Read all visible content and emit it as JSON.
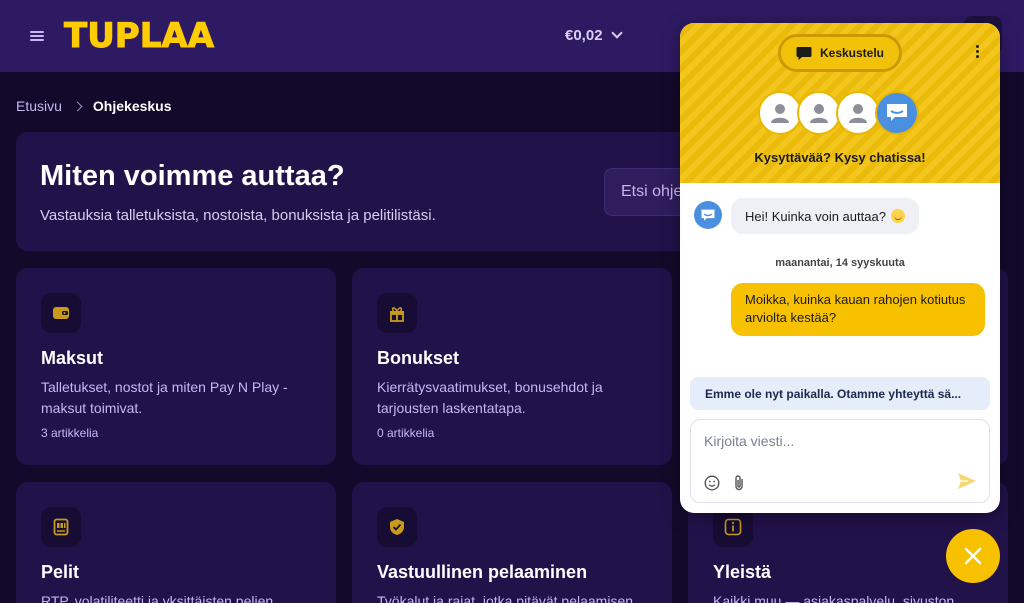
{
  "header": {
    "logo": "TUPLAA",
    "balance": "€0,02"
  },
  "breadcrumb": {
    "home": "Etusivu",
    "current": "Ohjekeskus"
  },
  "hero": {
    "title": "Miten voimme auttaa?",
    "subtitle": "Vastauksia talletuksista, nostoista, bonuksista ja pelitilistäsi.",
    "search_placeholder": "Etsi ohjeita"
  },
  "cards": [
    {
      "title": "Maksut",
      "description": "Talletukset, nostot ja miten Pay N Play -maksut toimivat.",
      "count": "3 artikkelia",
      "icon": "wallet-icon"
    },
    {
      "title": "Bonukset",
      "description": "Kierrätysvaatimukset, bonusehdot ja tarjousten laskentatapa.",
      "count": "0 artikkelia",
      "icon": "gift-icon"
    },
    {
      "title": "Pelit",
      "description": "RTP, volatiliteetti ja yksittäisten pelien",
      "count": "",
      "icon": "slot-machine-icon"
    },
    {
      "title": "Vastuullinen pelaaminen",
      "description": "Työkalut ja rajat, jotka pitävät pelaamisen",
      "count": "",
      "icon": "shield-check-icon"
    },
    {
      "title": "Yleistä",
      "description": "Kaikki muu — asiakaspalvelu, sivuston",
      "count": "",
      "icon": "info-icon"
    }
  ],
  "chat": {
    "tab_label": "Keskustelu",
    "tagline": "Kysyttävää? Kysy chatissa!",
    "bot_greeting": "Hei! Kuinka voin auttaa?",
    "date_separator": "maanantai, 14 syyskuuta",
    "user_message": "Moikka, kuinka kauan rahojen kotiutus arviolta kestää?",
    "offline_notice": "Emme ole nyt paikalla. Otamme yhteyttä sä...",
    "composer_placeholder": "Kirjoita viesti..."
  },
  "colors": {
    "header_bg": "#2e1a63",
    "page_bg": "#130a2b",
    "card_bg": "#22124a",
    "brand_yellow": "#f7c100",
    "link_lavender": "#c6b6f6",
    "bot_blue": "#4a8fe0"
  }
}
